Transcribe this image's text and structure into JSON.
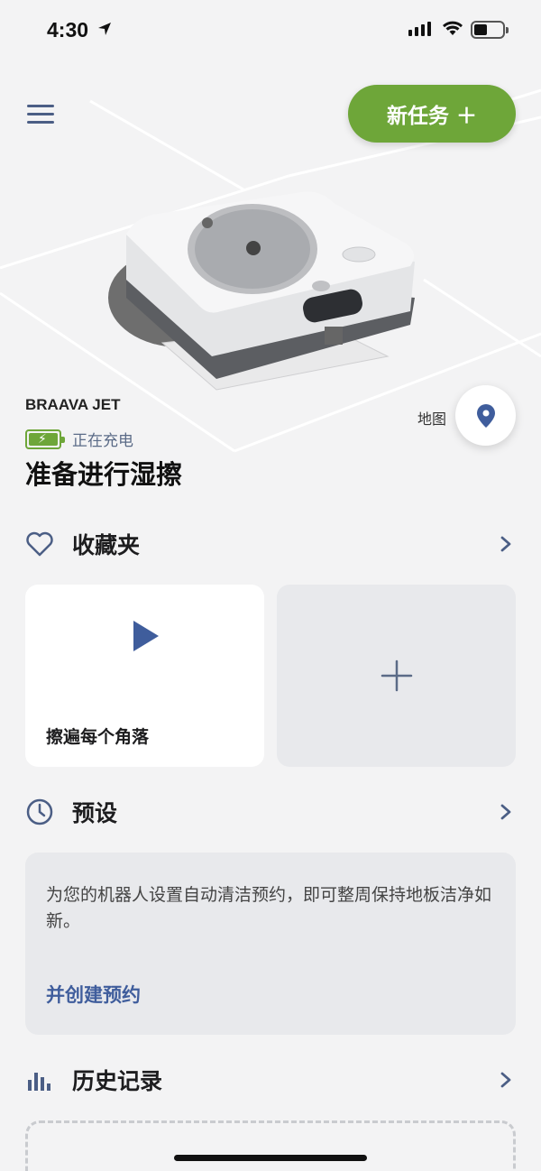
{
  "status_bar": {
    "time": "4:30"
  },
  "header": {
    "new_task_label": "新任务 ＋"
  },
  "robot": {
    "name": "BRAAVA JET",
    "charging_status": "正在充电",
    "ready_state": "准备进行湿擦",
    "map_label": "地图"
  },
  "favorites": {
    "title": "收藏夹",
    "card_label": "擦遍每个角落"
  },
  "schedule": {
    "title": "预设",
    "description": "为您的机器人设置自动清洁预约，即可整周保持地板洁净如新。",
    "create_link": "并创建预约"
  },
  "history": {
    "title": "历史记录"
  },
  "colors": {
    "accent_green": "#6ea639",
    "accent_blue": "#3f5d9c",
    "icon_slate": "#4b5e85"
  },
  "icons": [
    "location-arrow-icon",
    "signal-icon",
    "wifi-icon",
    "battery-icon",
    "menu-icon",
    "map-pin-icon",
    "heart-icon",
    "play-icon",
    "plus-icon",
    "clock-icon",
    "bar-chart-icon",
    "chevron-right-icon"
  ]
}
